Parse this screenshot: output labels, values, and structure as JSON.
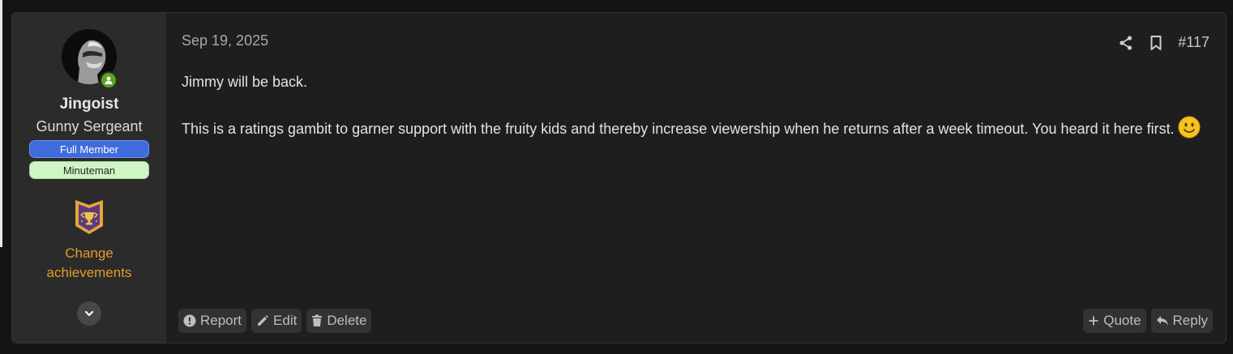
{
  "user": {
    "name": "Jingoist",
    "title": "Gunny Sergeant",
    "banners": [
      "Full Member",
      "Minuteman"
    ],
    "achievements_link": "Change achievements"
  },
  "post": {
    "date": "Sep 19, 2025",
    "number": "#117",
    "paragraphs": [
      "Jimmy will be back.",
      "This is a ratings gambit to garner support with the fruity kids and thereby increase viewership when he returns after a week timeout. You heard it here first."
    ]
  },
  "actions": {
    "report": "Report",
    "edit": "Edit",
    "delete": "Delete",
    "quote": "Quote",
    "reply": "Reply"
  },
  "icons": {
    "share": "share-icon",
    "bookmark": "bookmark-icon",
    "report": "alert-circle-icon",
    "edit": "pencil-icon",
    "delete": "trash-icon",
    "quote": "plus-icon",
    "reply": "reply-arrow-icon",
    "expand": "chevron-down-icon",
    "smilie": "smile-emoji-icon",
    "trophy": "trophy-shield-icon",
    "online": "online-user-icon"
  },
  "colors": {
    "background": "#141414",
    "post_bg": "#1e1e1e",
    "user_pane_bg": "#2b2b2b",
    "achievement_link": "#e39b2c",
    "full_member_banner": "#3f6bdc",
    "minuteman_banner": "#cff5c4",
    "online_dot": "#5aa31c"
  }
}
